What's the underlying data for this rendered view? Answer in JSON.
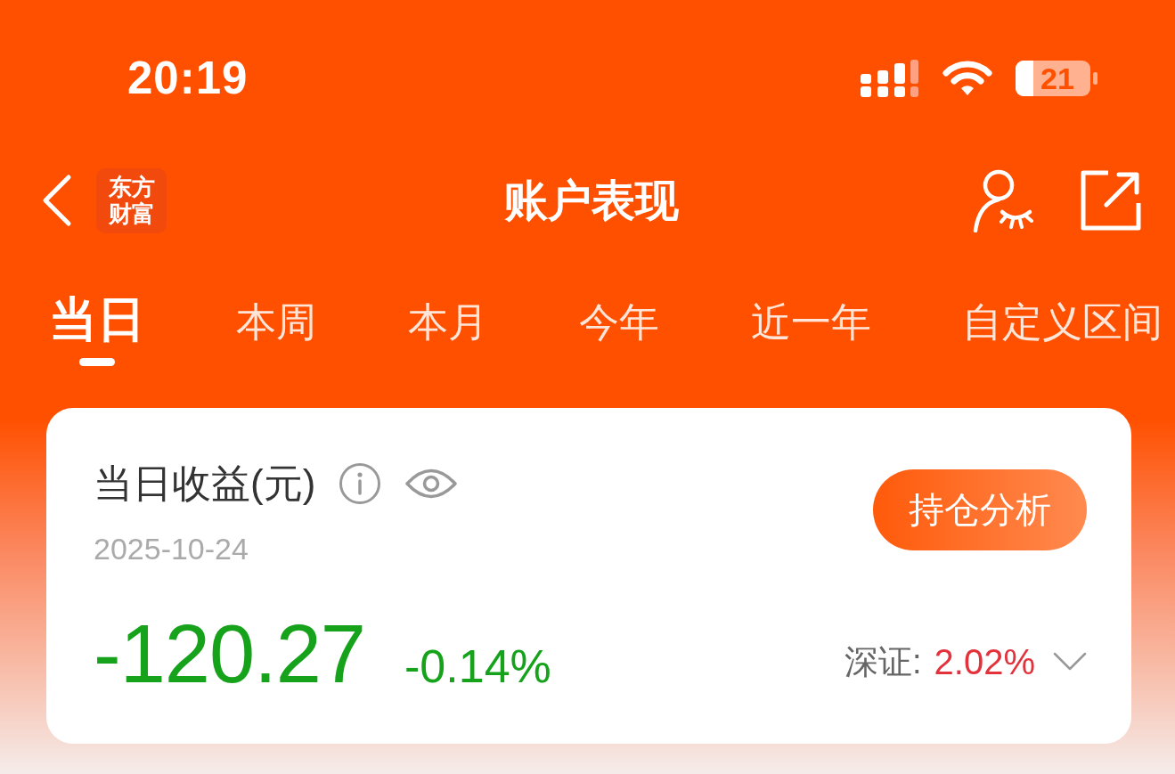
{
  "status_bar": {
    "time": "20:19",
    "battery": "21"
  },
  "nav": {
    "logo": [
      "东方",
      "财富"
    ],
    "title": "账户表现"
  },
  "tabs": [
    {
      "label": "当日",
      "selected": true
    },
    {
      "label": "本周",
      "selected": false
    },
    {
      "label": "本月",
      "selected": false
    },
    {
      "label": "今年",
      "selected": false
    },
    {
      "label": "近一年",
      "selected": false
    },
    {
      "label": "自定义区间",
      "selected": false
    }
  ],
  "card": {
    "title": "当日收益(元)",
    "date": "2025-10-24",
    "button": "持仓分析",
    "profit": {
      "value": "-120.27",
      "color": "#17a21c"
    },
    "profit_rate": {
      "value": "-0.14%",
      "color": "#17a21c"
    },
    "benchmark": {
      "label": "深证:",
      "value": "2.02%",
      "color": "#e3323c"
    }
  }
}
